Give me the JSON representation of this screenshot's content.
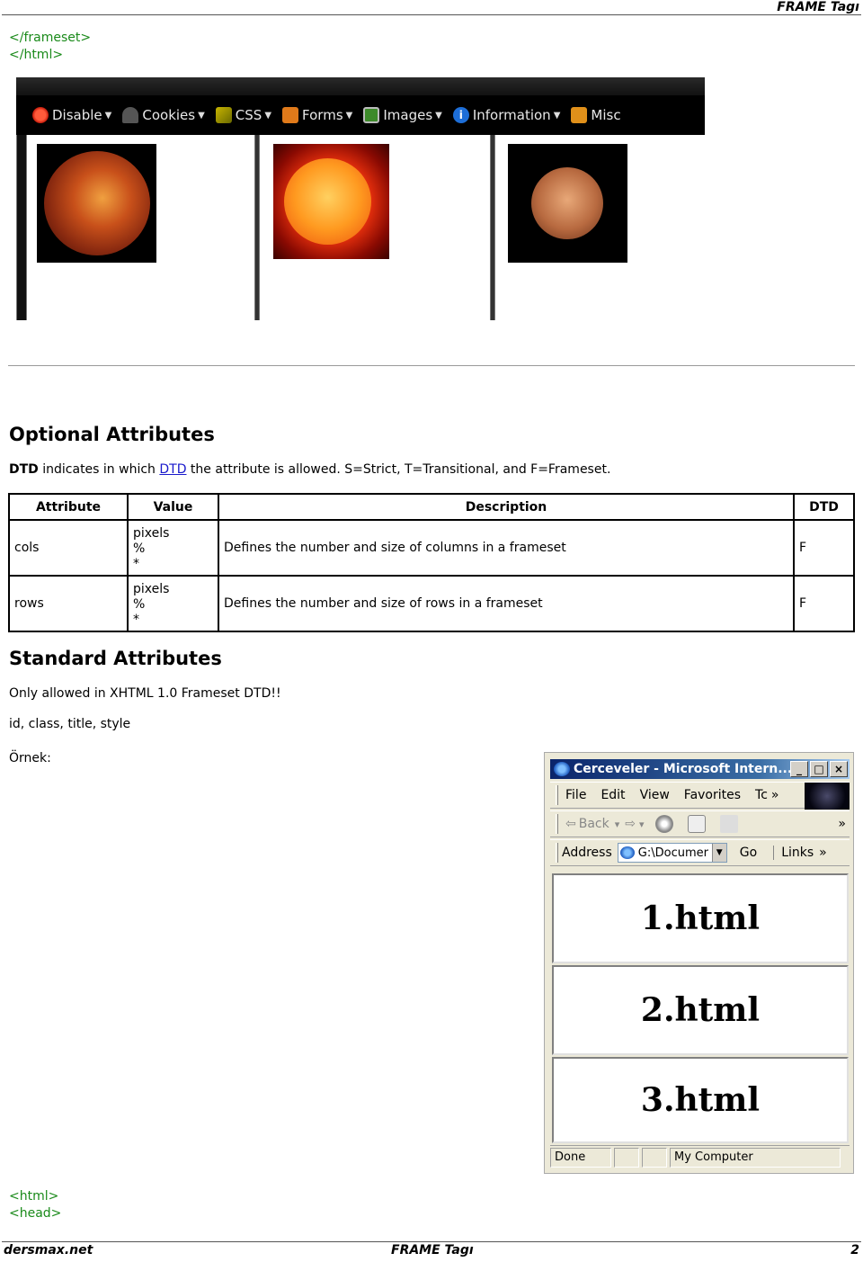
{
  "header": {
    "title": "FRAME Tagı"
  },
  "code_top": [
    "</frameset>",
    "</html>"
  ],
  "toolbar_screenshot": {
    "items": [
      {
        "label": "Disable",
        "icon": "disable-icon"
      },
      {
        "label": "Cookies",
        "icon": "cookies-icon"
      },
      {
        "label": "CSS",
        "icon": "css-icon"
      },
      {
        "label": "Forms",
        "icon": "forms-icon"
      },
      {
        "label": "Images",
        "icon": "images-icon"
      },
      {
        "label": "Information",
        "icon": "info-icon",
        "glyph": "i"
      },
      {
        "label": "Misc",
        "icon": "misc-icon"
      }
    ],
    "dropdown_glyph": "▼",
    "frames": [
      "Venus planet image",
      "Sun image",
      "Mercury planet image"
    ]
  },
  "optional": {
    "heading": "Optional Attributes",
    "intro_bold": "DTD",
    "intro_mid": " indicates in which ",
    "intro_link": "DTD",
    "intro_rest": " the attribute is allowed. S=Strict, T=Transitional, and F=Frameset."
  },
  "table": {
    "headers": [
      "Attribute",
      "Value",
      "Description",
      "DTD"
    ],
    "rows": [
      {
        "attribute": "cols",
        "values": [
          "pixels",
          "%",
          "*"
        ],
        "description": "Defines the number and size of columns in a frameset",
        "dtd": "F"
      },
      {
        "attribute": "rows",
        "values": [
          "pixels",
          "%",
          "*"
        ],
        "description": "Defines the number and size of rows in a frameset",
        "dtd": "F"
      }
    ]
  },
  "standard": {
    "heading": "Standard Attributes",
    "note": "Only allowed in XHTML 1.0 Frameset DTD!!",
    "list": "id, class, title, style",
    "example_label": "Örnek:"
  },
  "ie_window": {
    "title": "Cerceveler - Microsoft Intern...",
    "buttons": {
      "minimize": "_",
      "maximize": "□",
      "close": "×"
    },
    "menu": [
      "File",
      "Edit",
      "View",
      "Favorites",
      "Tc"
    ],
    "more": "»",
    "nav": {
      "back": "Back",
      "back_arrow": "⇦",
      "fwd_arrow": "⇨",
      "dropdown": "▾"
    },
    "address_label": "Address",
    "address_value": "G:\\Documer",
    "go_label": "Go",
    "links_label": "Links",
    "frames": [
      "1.html",
      "2.html",
      "3.html"
    ],
    "status_text": "Done",
    "zone_text": "My Computer"
  },
  "code_bottom": [
    "<html>",
    "<head>"
  ],
  "footer": {
    "left": "dersmax.net",
    "center": "FRAME Tagı",
    "page": "2"
  }
}
